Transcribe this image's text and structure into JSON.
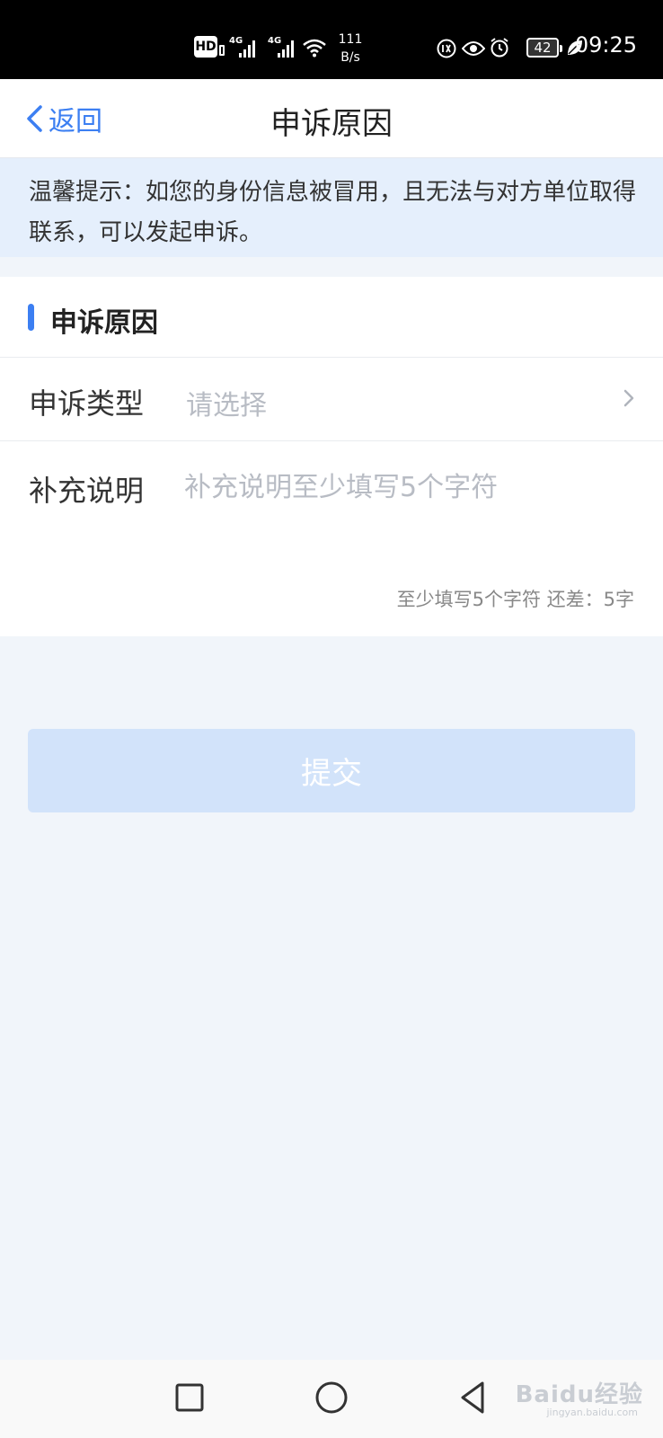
{
  "status_bar": {
    "hd": "HD",
    "sim1_label": "4G",
    "sim2_label": "4G",
    "speed_value": "111",
    "speed_unit": "B/s",
    "battery": "42",
    "time": "09:25",
    "icons": [
      "hd-icon",
      "signal-icon",
      "signal-icon",
      "wifi-icon",
      "data-saver-icon",
      "eye-comfort-icon",
      "alarm-icon",
      "battery-icon",
      "leaf-icon"
    ]
  },
  "nav": {
    "back_label": "返回",
    "title": "申诉原因"
  },
  "tip": {
    "text": "温馨提示：如您的身份信息被冒用，且无法与对方单位取得联系，可以发起申诉。"
  },
  "form": {
    "section_title": "申诉原因",
    "type_label": "申诉类型",
    "type_placeholder": "请选择",
    "desc_label": "补充说明",
    "desc_placeholder": "补充说明至少填写5个字符",
    "counter_text": "至少填写5个字符 还差：5字"
  },
  "submit": {
    "label": "提交"
  },
  "system_nav": {
    "buttons": [
      "square-recent-icon",
      "circle-home-icon",
      "triangle-back-icon"
    ],
    "watermark": "Baidu经验",
    "watermark_url": "jingyan.baidu.com"
  },
  "colors": {
    "accent": "#3c7ff2",
    "tip_bg": "#e5effc",
    "page_bg": "#f1f5fa",
    "submit_disabled": "#d2e3fa"
  }
}
